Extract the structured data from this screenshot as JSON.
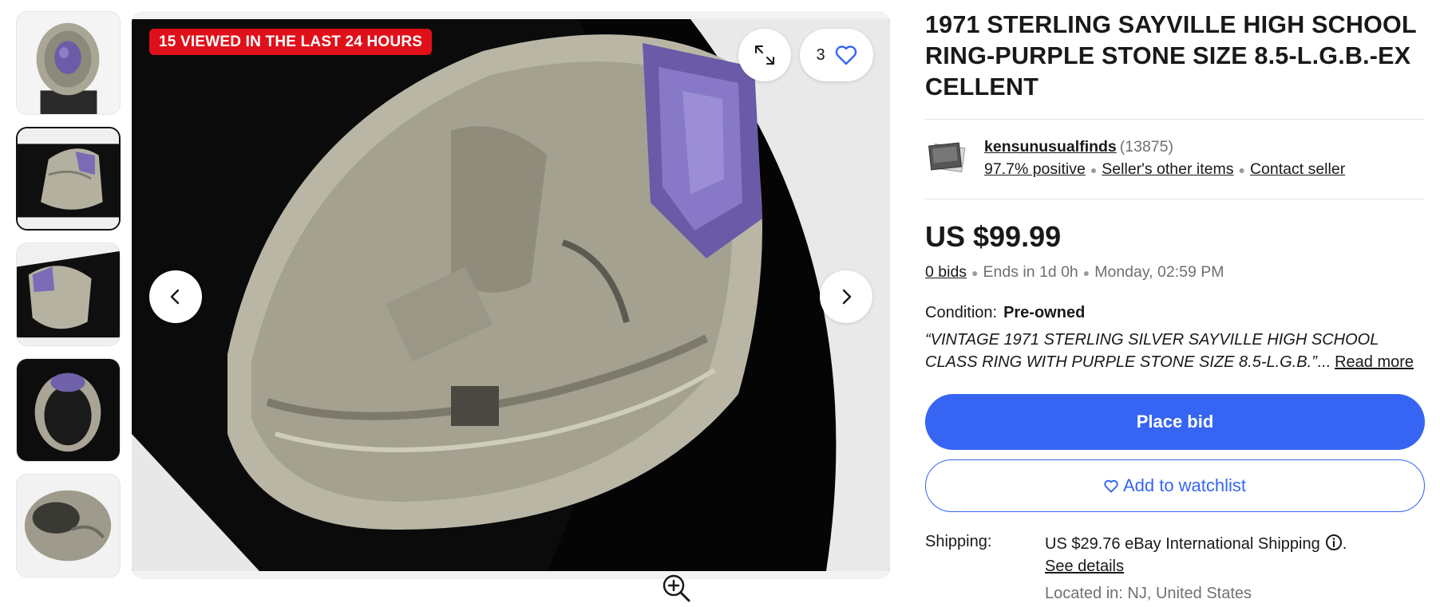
{
  "gallery": {
    "thumbnails": [
      {
        "name": "thumb-1",
        "selected": false
      },
      {
        "name": "thumb-2",
        "selected": true
      },
      {
        "name": "thumb-3",
        "selected": false
      },
      {
        "name": "thumb-4",
        "selected": false
      },
      {
        "name": "thumb-5",
        "selected": false
      }
    ],
    "viewed_badge": "15 VIEWED IN THE LAST 24 HOURS",
    "watch_count": "3",
    "icons": {
      "expand": "expand-icon",
      "heart": "heart-icon",
      "prev": "chevron-left-icon",
      "next": "chevron-right-icon",
      "zoom": "zoom-in-icon"
    }
  },
  "listing": {
    "title": "1971 STERLING SAYVILLE HIGH SCHOOL RING-PURPLE STONE SIZE 8.5-L.G.B.-EXCELLENT",
    "seller": {
      "name": "kensunusualfinds",
      "count": "(13875)",
      "positive": "97.7% positive",
      "other_items": "Seller's other items",
      "contact": "Contact seller"
    },
    "price": "US $99.99",
    "bids": "0 bids",
    "ends": "Ends in 1d 0h",
    "end_time": "Monday, 02:59 PM",
    "condition_label": "Condition:",
    "condition_value": "Pre-owned",
    "description": "“VINTAGE 1971 STERLING SILVER SAYVILLE HIGH SCHOOL CLASS RING WITH PURPLE STONE SIZE 8.5-L.G.B.”",
    "ellipsis": "...",
    "read_more": "Read more",
    "place_bid": "Place bid",
    "add_watchlist": "Add to watchlist",
    "shipping_label": "Shipping:",
    "shipping_price": "US $29.76",
    "shipping_service": "eBay International Shipping",
    "shipping_period": ".",
    "see_details": "See details",
    "located": "Located in: NJ, United States"
  },
  "colors": {
    "primary": "#3665f3",
    "badge": "#e0101a",
    "text": "#191919",
    "muted": "#707070"
  }
}
